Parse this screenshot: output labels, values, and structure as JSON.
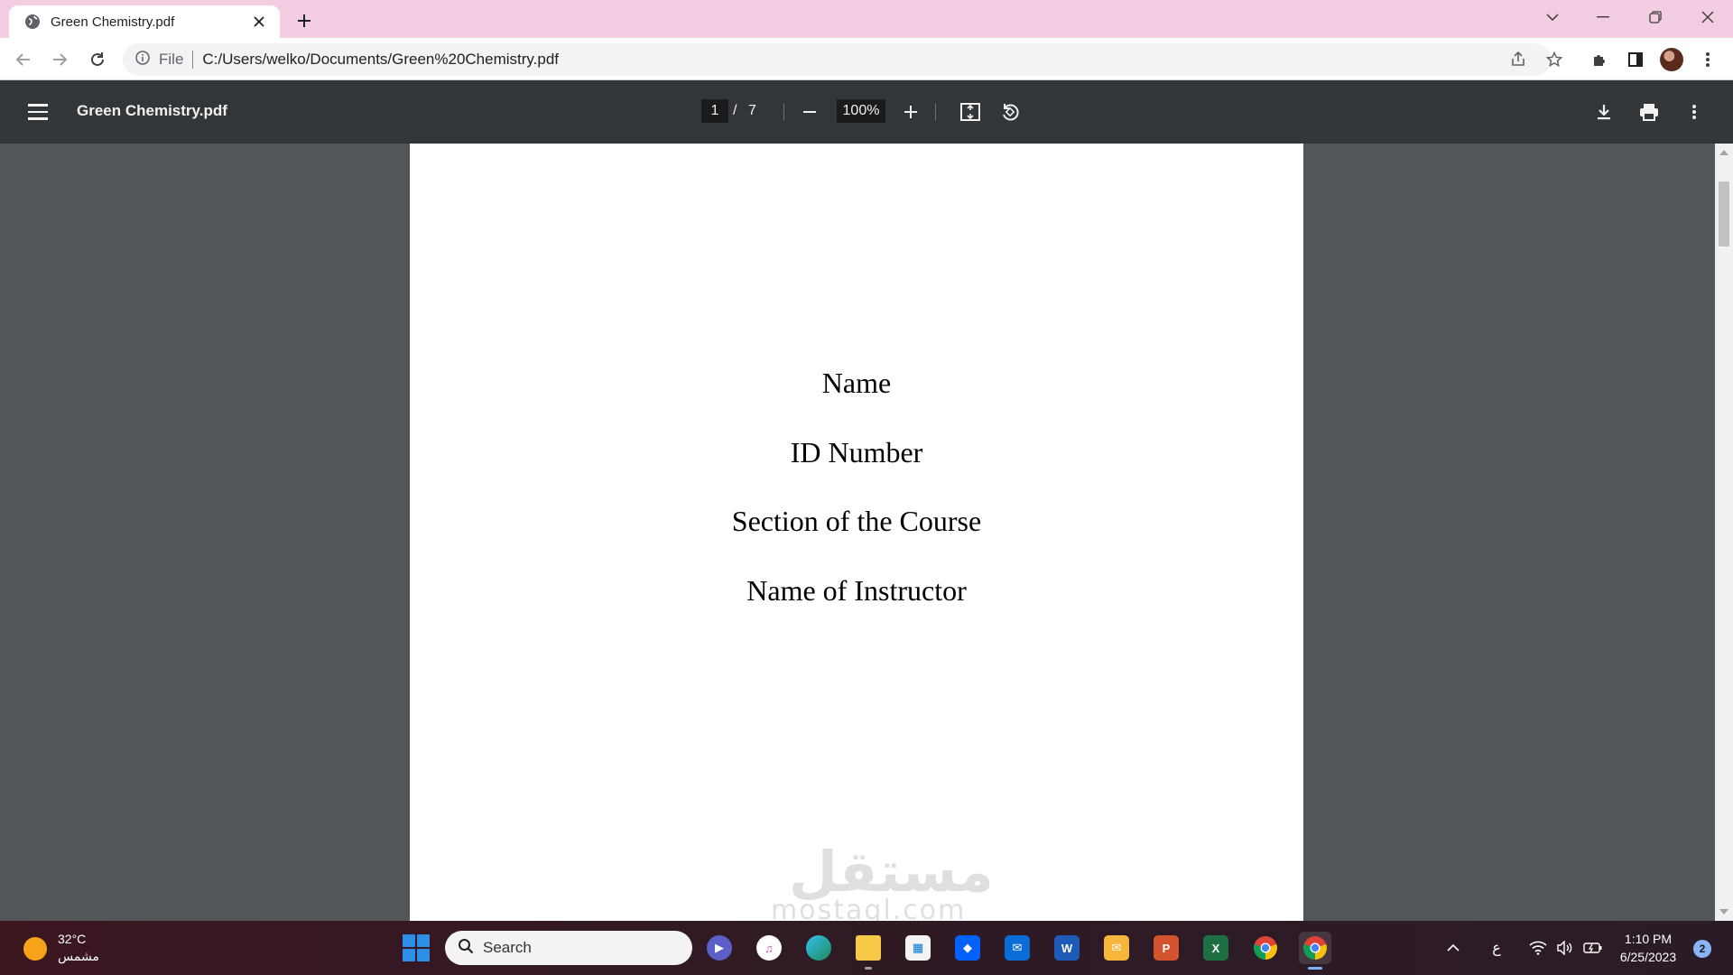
{
  "browser": {
    "tab_title": "Green Chemistry.pdf",
    "url_scheme": "File",
    "url": "C:/Users/welko/Documents/Green%20Chemistry.pdf"
  },
  "viewer": {
    "title": "Green Chemistry.pdf",
    "page_current": "1",
    "page_separator": "/",
    "page_total": "7",
    "zoom": "100%"
  },
  "document": {
    "lines": [
      "Name",
      "ID Number",
      "Section of the Course",
      "Name of Instructor"
    ],
    "watermark_arabic": "مستقل",
    "watermark_latin": "mostaql.com"
  },
  "taskbar": {
    "weather_temp": "32°C",
    "weather_condition": "مشمس",
    "search_label": "Search",
    "time": "1:10 PM",
    "date": "6/25/2023",
    "notification_count": "2",
    "keyboard_lang": "ع"
  },
  "colors": {
    "tabstrip_bg": "#f3cde1",
    "pdf_toolbar_bg": "#323639",
    "doc_bg": "#525659",
    "taskbar_bg": "#3a1a20"
  }
}
